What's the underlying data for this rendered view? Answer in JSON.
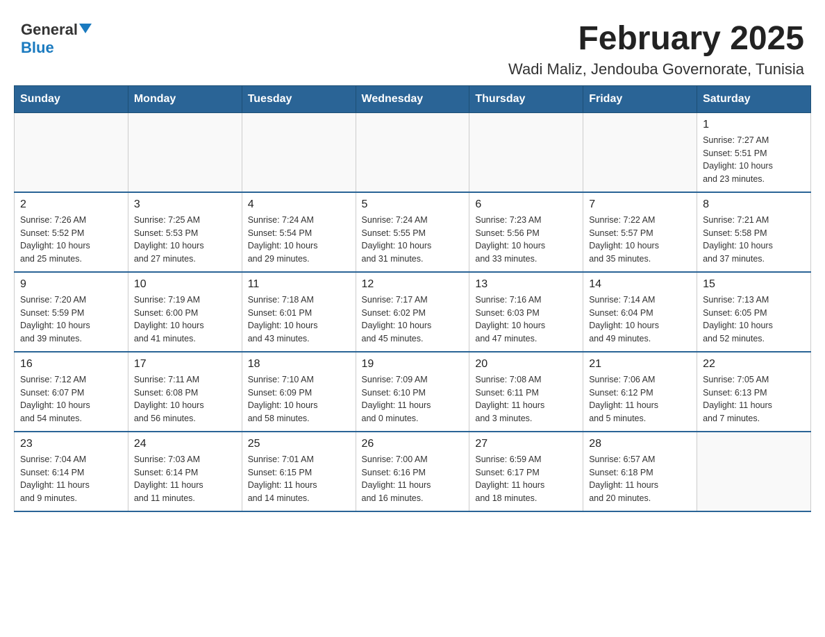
{
  "header": {
    "logo": {
      "general": "General",
      "blue": "Blue",
      "triangle": "▼"
    },
    "title": "February 2025",
    "subtitle": "Wadi Maliz, Jendouba Governorate, Tunisia"
  },
  "calendar": {
    "days_of_week": [
      "Sunday",
      "Monday",
      "Tuesday",
      "Wednesday",
      "Thursday",
      "Friday",
      "Saturday"
    ],
    "weeks": [
      [
        {
          "day": "",
          "info": ""
        },
        {
          "day": "",
          "info": ""
        },
        {
          "day": "",
          "info": ""
        },
        {
          "day": "",
          "info": ""
        },
        {
          "day": "",
          "info": ""
        },
        {
          "day": "",
          "info": ""
        },
        {
          "day": "1",
          "info": "Sunrise: 7:27 AM\nSunset: 5:51 PM\nDaylight: 10 hours\nand 23 minutes."
        }
      ],
      [
        {
          "day": "2",
          "info": "Sunrise: 7:26 AM\nSunset: 5:52 PM\nDaylight: 10 hours\nand 25 minutes."
        },
        {
          "day": "3",
          "info": "Sunrise: 7:25 AM\nSunset: 5:53 PM\nDaylight: 10 hours\nand 27 minutes."
        },
        {
          "day": "4",
          "info": "Sunrise: 7:24 AM\nSunset: 5:54 PM\nDaylight: 10 hours\nand 29 minutes."
        },
        {
          "day": "5",
          "info": "Sunrise: 7:24 AM\nSunset: 5:55 PM\nDaylight: 10 hours\nand 31 minutes."
        },
        {
          "day": "6",
          "info": "Sunrise: 7:23 AM\nSunset: 5:56 PM\nDaylight: 10 hours\nand 33 minutes."
        },
        {
          "day": "7",
          "info": "Sunrise: 7:22 AM\nSunset: 5:57 PM\nDaylight: 10 hours\nand 35 minutes."
        },
        {
          "day": "8",
          "info": "Sunrise: 7:21 AM\nSunset: 5:58 PM\nDaylight: 10 hours\nand 37 minutes."
        }
      ],
      [
        {
          "day": "9",
          "info": "Sunrise: 7:20 AM\nSunset: 5:59 PM\nDaylight: 10 hours\nand 39 minutes."
        },
        {
          "day": "10",
          "info": "Sunrise: 7:19 AM\nSunset: 6:00 PM\nDaylight: 10 hours\nand 41 minutes."
        },
        {
          "day": "11",
          "info": "Sunrise: 7:18 AM\nSunset: 6:01 PM\nDaylight: 10 hours\nand 43 minutes."
        },
        {
          "day": "12",
          "info": "Sunrise: 7:17 AM\nSunset: 6:02 PM\nDaylight: 10 hours\nand 45 minutes."
        },
        {
          "day": "13",
          "info": "Sunrise: 7:16 AM\nSunset: 6:03 PM\nDaylight: 10 hours\nand 47 minutes."
        },
        {
          "day": "14",
          "info": "Sunrise: 7:14 AM\nSunset: 6:04 PM\nDaylight: 10 hours\nand 49 minutes."
        },
        {
          "day": "15",
          "info": "Sunrise: 7:13 AM\nSunset: 6:05 PM\nDaylight: 10 hours\nand 52 minutes."
        }
      ],
      [
        {
          "day": "16",
          "info": "Sunrise: 7:12 AM\nSunset: 6:07 PM\nDaylight: 10 hours\nand 54 minutes."
        },
        {
          "day": "17",
          "info": "Sunrise: 7:11 AM\nSunset: 6:08 PM\nDaylight: 10 hours\nand 56 minutes."
        },
        {
          "day": "18",
          "info": "Sunrise: 7:10 AM\nSunset: 6:09 PM\nDaylight: 10 hours\nand 58 minutes."
        },
        {
          "day": "19",
          "info": "Sunrise: 7:09 AM\nSunset: 6:10 PM\nDaylight: 11 hours\nand 0 minutes."
        },
        {
          "day": "20",
          "info": "Sunrise: 7:08 AM\nSunset: 6:11 PM\nDaylight: 11 hours\nand 3 minutes."
        },
        {
          "day": "21",
          "info": "Sunrise: 7:06 AM\nSunset: 6:12 PM\nDaylight: 11 hours\nand 5 minutes."
        },
        {
          "day": "22",
          "info": "Sunrise: 7:05 AM\nSunset: 6:13 PM\nDaylight: 11 hours\nand 7 minutes."
        }
      ],
      [
        {
          "day": "23",
          "info": "Sunrise: 7:04 AM\nSunset: 6:14 PM\nDaylight: 11 hours\nand 9 minutes."
        },
        {
          "day": "24",
          "info": "Sunrise: 7:03 AM\nSunset: 6:14 PM\nDaylight: 11 hours\nand 11 minutes."
        },
        {
          "day": "25",
          "info": "Sunrise: 7:01 AM\nSunset: 6:15 PM\nDaylight: 11 hours\nand 14 minutes."
        },
        {
          "day": "26",
          "info": "Sunrise: 7:00 AM\nSunset: 6:16 PM\nDaylight: 11 hours\nand 16 minutes."
        },
        {
          "day": "27",
          "info": "Sunrise: 6:59 AM\nSunset: 6:17 PM\nDaylight: 11 hours\nand 18 minutes."
        },
        {
          "day": "28",
          "info": "Sunrise: 6:57 AM\nSunset: 6:18 PM\nDaylight: 11 hours\nand 20 minutes."
        },
        {
          "day": "",
          "info": ""
        }
      ]
    ]
  }
}
